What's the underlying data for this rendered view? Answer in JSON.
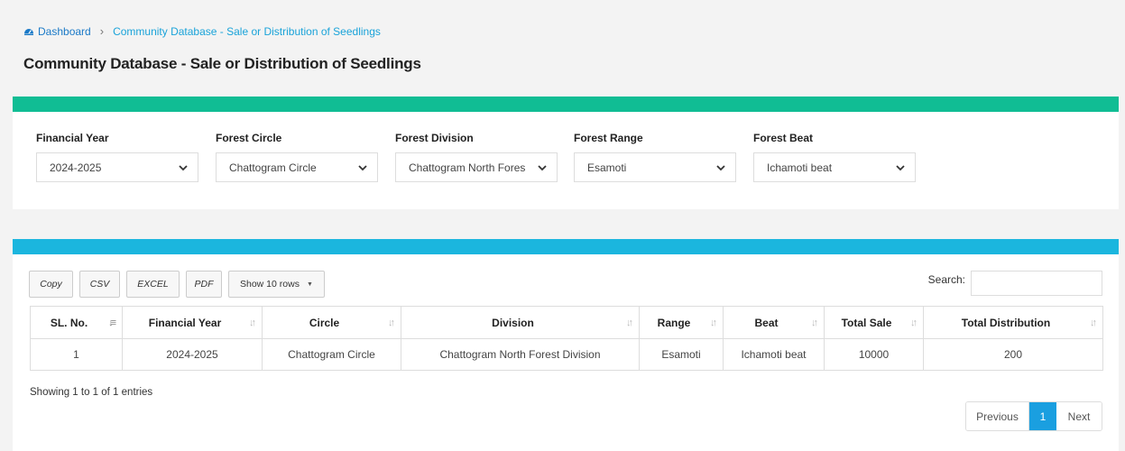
{
  "breadcrumb": {
    "home_label": "Dashboard",
    "separator": "›",
    "current_label": "Community Database - Sale or Distribution of Seedlings",
    "home_icon": "dashboard-icon"
  },
  "page": {
    "title": "Community Database - Sale or Distribution of Seedlings"
  },
  "filters": [
    {
      "label": "Financial Year",
      "value": "2024-2025"
    },
    {
      "label": "Forest Circle",
      "value": "Chattogram Circle"
    },
    {
      "label": "Forest Division",
      "value": "Chattogram North Fores"
    },
    {
      "label": "Forest Range",
      "value": "Esamoti"
    },
    {
      "label": "Forest Beat",
      "value": "Ichamoti beat"
    }
  ],
  "toolbar": {
    "copy": "Copy",
    "csv": "CSV",
    "excel": "EXCEL",
    "pdf": "PDF",
    "show_rows": "Show 10 rows",
    "search_label": "Search:",
    "search_value": ""
  },
  "table": {
    "headers": [
      "SL. No.",
      "Financial Year",
      "Circle",
      "Division",
      "Range",
      "Beat",
      "Total Sale",
      "Total Distribution"
    ],
    "rows": [
      [
        "1",
        "2024-2025",
        "Chattogram Circle",
        "Chattogram North Forest Division",
        "Esamoti",
        "Ichamoti beat",
        "10000",
        "200"
      ]
    ]
  },
  "footer": {
    "info": "Showing 1 to 1 of 1 entries",
    "previous": "Previous",
    "current_page": "1",
    "next": "Next"
  },
  "colors": {
    "filter_bar": "#10bd94",
    "table_bar": "#1bb6de",
    "page_active": "#1a9fe0"
  }
}
